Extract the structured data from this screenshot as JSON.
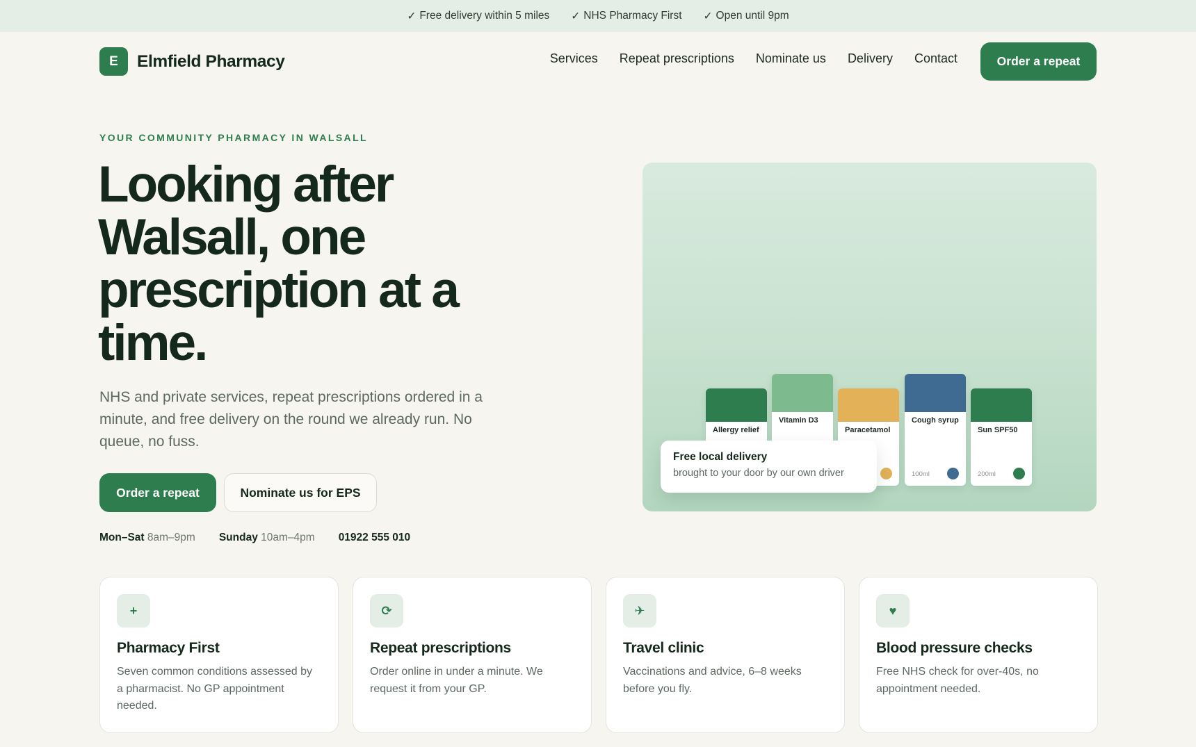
{
  "topbar": {
    "items": [
      {
        "check": "✓",
        "text": "Free delivery within 5 miles"
      },
      {
        "check": "✓",
        "text": "NHS Pharmacy First"
      },
      {
        "check": "✓",
        "text": "Open until 9pm"
      }
    ]
  },
  "header": {
    "logo_letter": "E",
    "brand": "Elmfield Pharmacy",
    "nav": [
      "Services",
      "Repeat prescriptions",
      "Nominate us",
      "Delivery",
      "Contact"
    ],
    "cta": "Order a repeat"
  },
  "hero": {
    "eyebrow": "YOUR COMMUNITY PHARMACY IN WALSALL",
    "title": "Looking after Walsall, one prescription at a time.",
    "subtitle": "NHS and private services, repeat prescriptions ordered in a minute, and free delivery on the round we already run. No queue, no fuss.",
    "primary_button": "Order a repeat",
    "secondary_button": "Nominate us for EPS",
    "hours": {
      "weekday_label": "Mon–Sat",
      "weekday_time": "8am–9pm",
      "sunday_label": "Sunday",
      "sunday_time": "10am–4pm",
      "phone": "01922 555 010"
    }
  },
  "illustration": {
    "products": [
      {
        "label": "Allergy relief",
        "volume": "",
        "color": "#2e7d4f"
      },
      {
        "label": "Vitamin D3",
        "volume": "",
        "color": "#7dba8e"
      },
      {
        "label": "Paracetamol",
        "volume": "",
        "color": "#e2b158"
      },
      {
        "label": "Cough syrup",
        "volume": "100ml",
        "color": "#3f6b92"
      },
      {
        "label": "Sun SPF50",
        "volume": "200ml",
        "color": "#2e7d4f"
      }
    ],
    "delivery_card": {
      "title": "Free local delivery",
      "subtitle": "brought to your door by our own driver"
    }
  },
  "services": [
    {
      "icon": "+",
      "icon_name": "plus-icon",
      "title": "Pharmacy First",
      "desc": "Seven common conditions assessed by a pharmacist. No GP appointment needed."
    },
    {
      "icon": "⟳",
      "icon_name": "refresh-icon",
      "title": "Repeat prescriptions",
      "desc": "Order online in under a minute. We request it from your GP."
    },
    {
      "icon": "✈",
      "icon_name": "plane-icon",
      "title": "Travel clinic",
      "desc": "Vaccinations and advice, 6–8 weeks before you fly."
    },
    {
      "icon": "♥",
      "icon_name": "heart-icon",
      "title": "Blood pressure checks",
      "desc": "Free NHS check for over-40s, no appointment needed."
    }
  ],
  "colors": {
    "accent": "#2e7d4f",
    "background": "#f6f5f0",
    "topbar": "#e4eee6",
    "heading": "#14281b"
  }
}
